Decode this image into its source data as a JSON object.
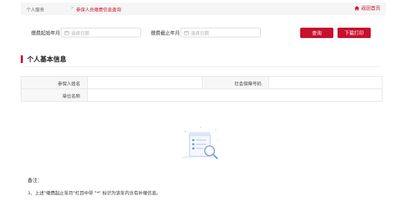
{
  "breadcrumb": {
    "home": "个人服务",
    "separator": ">",
    "current": "参保人员缴费信息查询"
  },
  "back_home": {
    "icon": "home-icon",
    "label": "返回首页"
  },
  "query": {
    "start_label": "缴费起始年月",
    "start_placeholder": "选择日期",
    "end_label": "缴费截止年月",
    "end_placeholder": "选择日期",
    "query_button": "查询",
    "print_button": "下载打印"
  },
  "section": {
    "title": "个人基本信息"
  },
  "info_table": {
    "name_label": "参保人姓名",
    "name_value": "",
    "ssn_label": "社会保障号码",
    "ssn_value": "",
    "unit_label": "单位名称",
    "unit_value": ""
  },
  "notes": {
    "title": "备注：",
    "items": [
      "1、上述\"缴费起止年月\"栏目中带 \"*\" 标识为该年内含有补缴信息。"
    ]
  },
  "colors": {
    "accent": "#c8102e",
    "topbar_bg": "#f5f5f5",
    "label_cell_bg": "#f7f7f7"
  }
}
